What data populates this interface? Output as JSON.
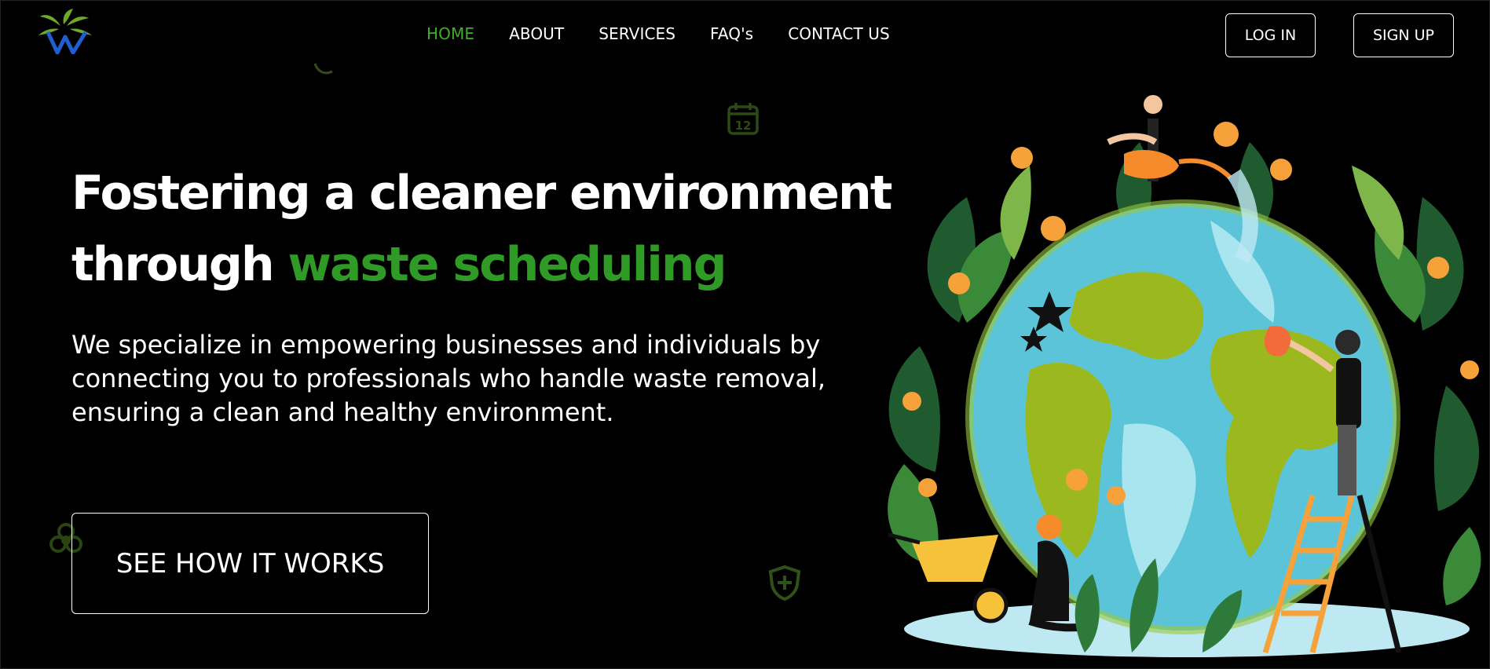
{
  "header": {
    "logo_icon": "leaf-w-logo",
    "nav": [
      {
        "label": "HOME",
        "active": true
      },
      {
        "label": "ABOUT",
        "active": false
      },
      {
        "label": "SERVICES",
        "active": false
      },
      {
        "label": "FAQ's",
        "active": false
      },
      {
        "label": "CONTACT US",
        "active": false
      }
    ],
    "login_label": "LOG IN",
    "signup_label": "SIGN UP"
  },
  "hero": {
    "headline_part1": "Fostering a cleaner environment",
    "headline_part2": "through",
    "headline_accent": "waste scheduling",
    "subtext": "We specialize in empowering businesses and individuals by connecting you to professionals who handle waste removal, ensuring a clean and healthy environment.",
    "cta_label": "SEE HOW IT WORKS",
    "calendar_badge": "12"
  },
  "colors": {
    "background": "#000000",
    "accent_green": "#2f9a25",
    "nav_active": "#3fae2a",
    "text": "#ffffff"
  },
  "illustration": "earth-care-illustration"
}
